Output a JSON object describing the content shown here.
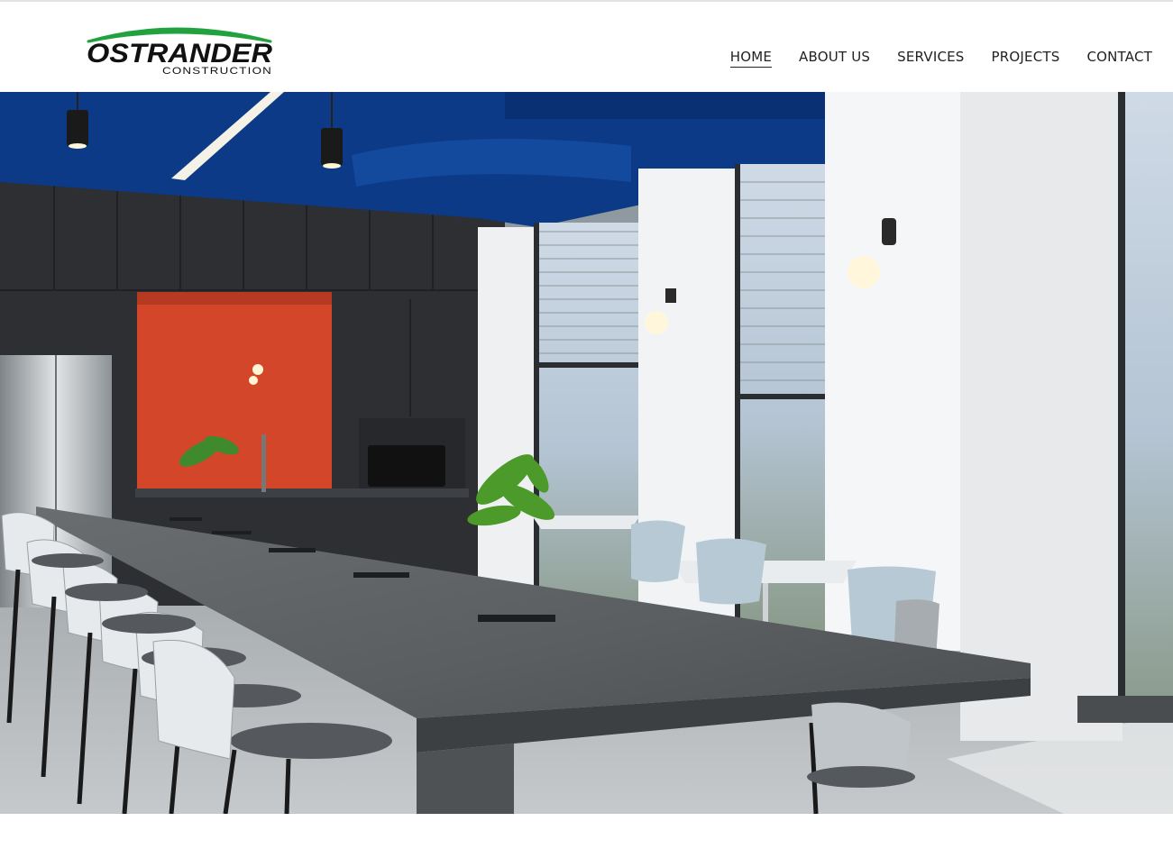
{
  "brand": {
    "name": "OSTRANDER",
    "tagline": "CONSTRUCTION",
    "accent_color": "#22a23f",
    "text_color": "#111111"
  },
  "nav": {
    "items": [
      {
        "label": "HOME",
        "active": true
      },
      {
        "label": "ABOUT US",
        "active": false
      },
      {
        "label": "SERVICES",
        "active": false
      },
      {
        "label": "PROJECTS",
        "active": false
      },
      {
        "label": "CONTACT",
        "active": false
      }
    ]
  },
  "hero": {
    "subject": "office break room with long island table, bar stools, kitchen cabinets and tall windows",
    "colors": {
      "ceiling": "#0d3a86",
      "accent_wall": "#d4462a",
      "table": "#55585b",
      "cabinets": "#2d2f33"
    }
  }
}
